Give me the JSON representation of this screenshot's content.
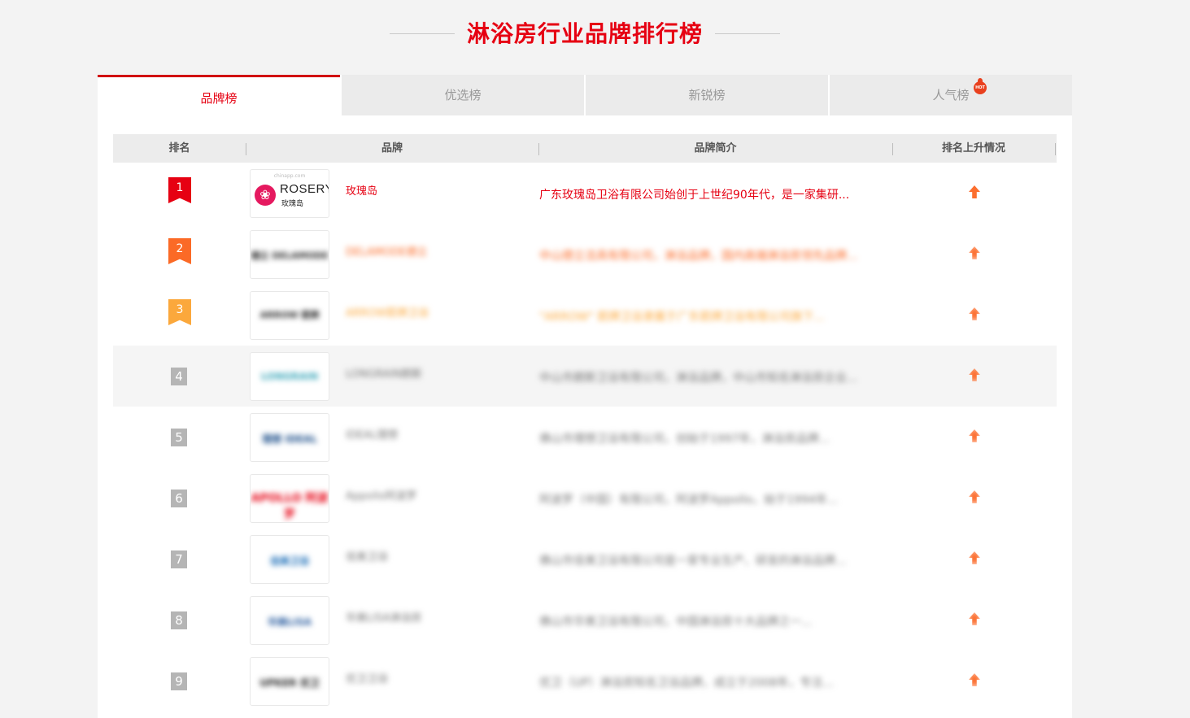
{
  "header": {
    "title": "淋浴房行业品牌排行榜"
  },
  "tabs": [
    {
      "label": "品牌榜",
      "active": true
    },
    {
      "label": "优选榜",
      "active": false
    },
    {
      "label": "新锐榜",
      "active": false
    },
    {
      "label": "人气榜",
      "active": false,
      "badge": "HOT"
    }
  ],
  "table": {
    "headers": [
      "排名",
      "品牌",
      "品牌简介",
      "排名上升情况"
    ],
    "rows": [
      {
        "rank": "1",
        "logo_top": "chinapp.com",
        "logo_name": "ROSERY",
        "logo_cn": "玫瑰岛",
        "brand": "玫瑰岛",
        "desc": "广东玫瑰岛卫浴有限公司始创于上世纪90年代，是一家集研...",
        "trend": "up-arrow-icon"
      },
      {
        "rank": "2",
        "logo_text": "德立 DELAMODE",
        "brand": "DELAMODE德立",
        "desc": "中山德立洁具有限公司，淋浴品牌，国内高端淋浴房领先品牌...",
        "trend": "up-arrow-icon"
      },
      {
        "rank": "3",
        "logo_text": "ARROW 箭牌",
        "brand": "ARROW箭牌卫浴",
        "desc": "\"ARROW\" 箭牌卫浴隶属于广东箭牌卫浴有限公司旗下...",
        "trend": "up-arrow-icon"
      },
      {
        "rank": "4",
        "logo_text": "LONGRAIN",
        "brand": "LONGRAIN朗斯",
        "desc": "中山市朗斯卫浴有限公司，淋浴品牌，中山市知名淋浴房企业...",
        "trend": "up-arrow-icon"
      },
      {
        "rank": "5",
        "logo_text": "理想 IDEAL",
        "brand": "IDEAL理想",
        "desc": "佛山市理想卫浴有限公司，创始于1997年，淋浴房品牌...",
        "trend": "up-arrow-icon"
      },
      {
        "rank": "6",
        "logo_text": "APOLLO 阿波罗",
        "brand": "Appollo阿波罗",
        "desc": "阿波罗（中国）有限公司，阿波罗Appollo，始于1994年...",
        "trend": "up-arrow-icon"
      },
      {
        "rank": "7",
        "logo_text": "佳美卫浴",
        "brand": "佳美卫浴",
        "desc": "佛山市佳美卫浴有限公司是一家专业生产、研发的淋浴品牌...",
        "trend": "up-arrow-icon"
      },
      {
        "rank": "8",
        "logo_text": "华美LISA",
        "brand": "华美LISA淋浴房",
        "desc": "佛山市华美卫浴有限公司，中国淋浴房十大品牌之一...",
        "trend": "up-arrow-icon"
      },
      {
        "rank": "9",
        "logo_text": "UPKER 优卫",
        "brand": "优卫卫浴",
        "desc": "优卫（UP）淋浴房知名卫浴品牌，成立于2008年，专注...",
        "trend": "up-arrow-icon"
      }
    ]
  },
  "colors": {
    "accent": "#e60012",
    "rank2": "#fb6a26",
    "rank3": "#fba83c",
    "rank_other": "#b5b5b5",
    "trend_arrow": "#fc6e2e"
  }
}
